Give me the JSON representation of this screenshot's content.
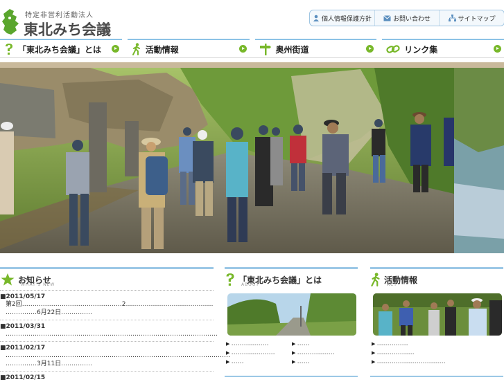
{
  "header": {
    "org_type": "特定非営利活動法人",
    "org_name": "東北みち会議"
  },
  "util_links": [
    {
      "label": "個人情報保護方針",
      "icon": "person-icon"
    },
    {
      "label": "お問い合わせ",
      "icon": "mail-icon"
    },
    {
      "label": "サイトマップ",
      "icon": "sitemap-icon"
    }
  ],
  "nav": [
    {
      "label": "「東北みち会議」とは",
      "icon": "question-icon"
    },
    {
      "label": "活動情報",
      "icon": "walker-icon"
    },
    {
      "label": "奥州街道",
      "icon": "signpost-icon"
    },
    {
      "label": "リンク集",
      "icon": "chain-link-icon"
    }
  ],
  "news": {
    "title": "お知らせ",
    "title_en": "WHAT'S NEW",
    "items": [
      {
        "date": "■2011/05/17",
        "text": "第2回…………………………………………2……………………………………",
        "text2": "……………6月22日……………"
      },
      {
        "date": "■2011/03/31",
        "text": "…………………………………………………………………………………………",
        "text2": ""
      },
      {
        "date": "■2011/02/17",
        "text": "………………………………………………………………………………………………",
        "text2": "……………3月11日……………"
      },
      {
        "date": "■2011/02/15",
        "text": "",
        "text2": ""
      }
    ]
  },
  "about": {
    "title": "「東北みち会議」とは",
    "title_en": "ABOUT",
    "links": [
      "………………",
      "……",
      "…………………",
      "………………",
      "……",
      "……"
    ]
  },
  "activity": {
    "title": "活動情報",
    "title_en": "ACT",
    "links": [
      "……………",
      "………………",
      "……………………………"
    ]
  },
  "colors": {
    "accent_blue": "#8cc2e6",
    "accent_green": "#78b82a",
    "logo_green": "#5aa62e"
  }
}
